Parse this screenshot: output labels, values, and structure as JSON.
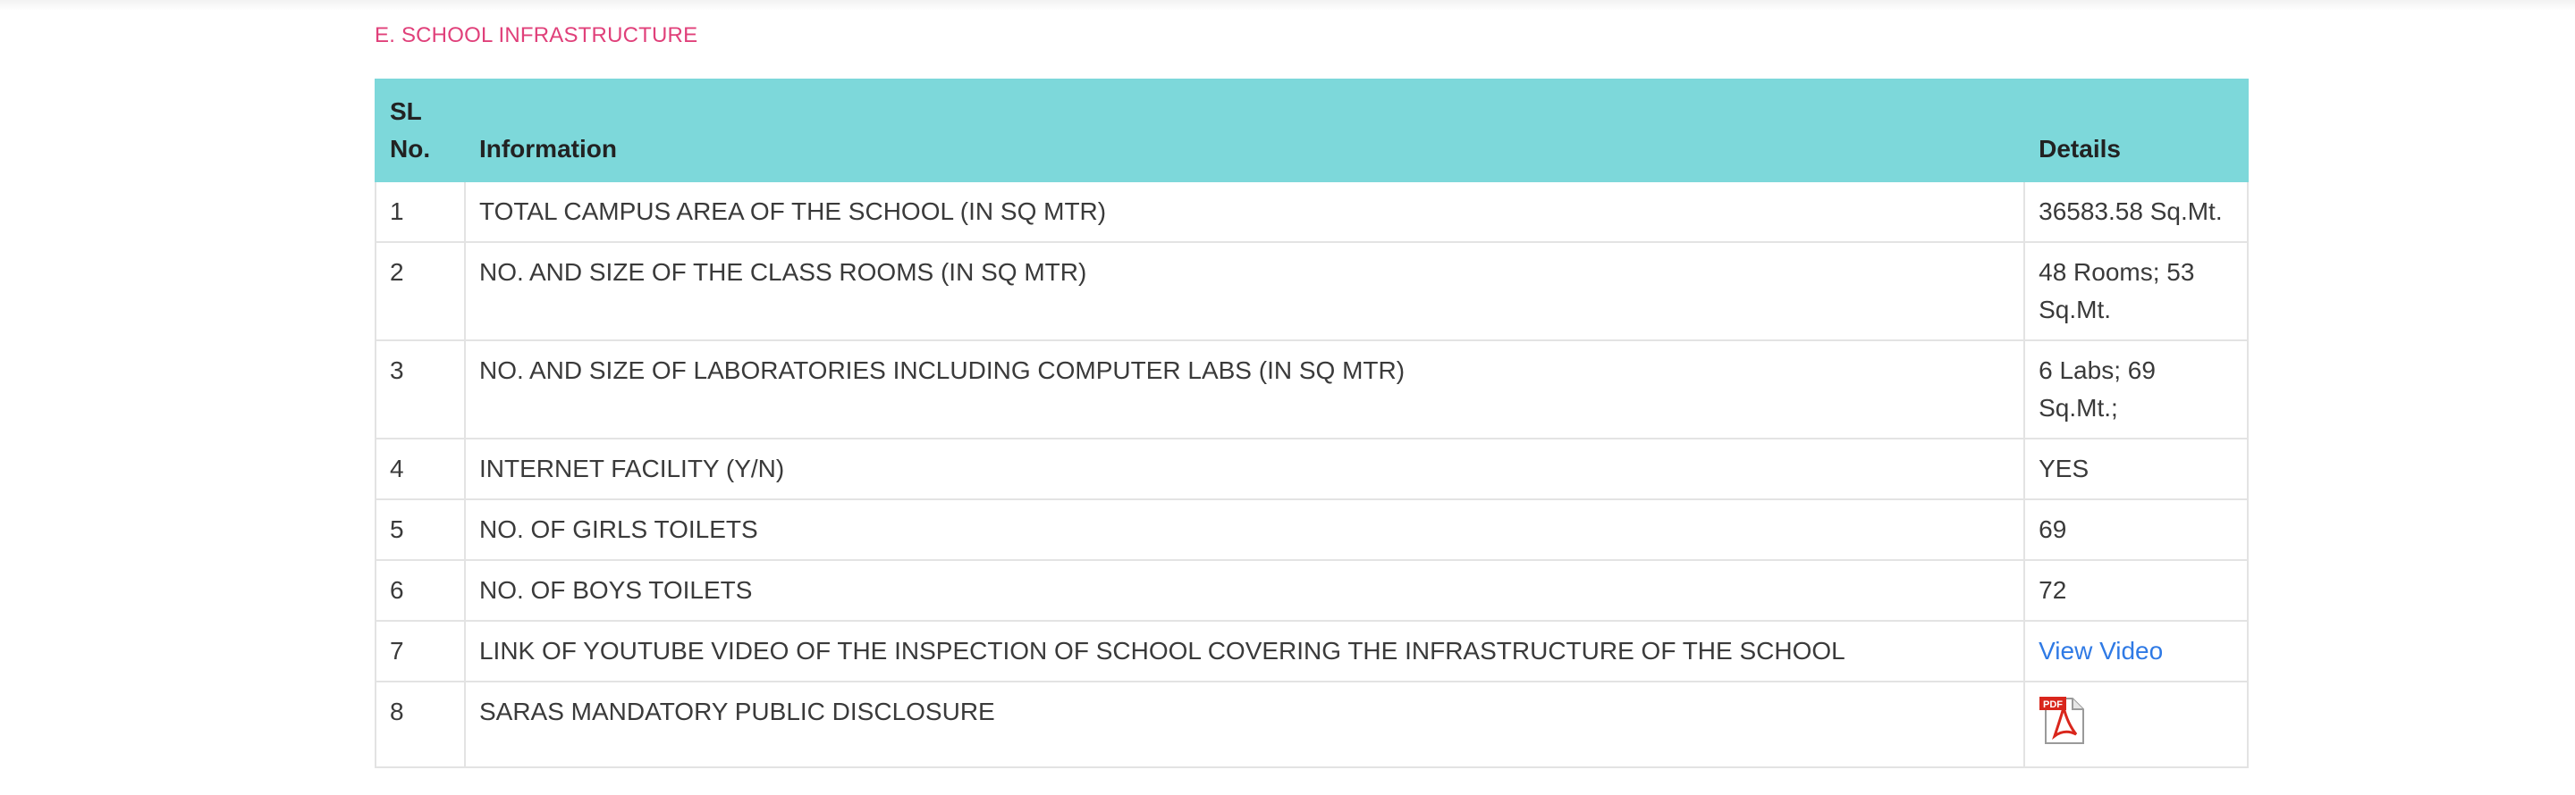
{
  "section": {
    "title": "E. SCHOOL INFRASTRUCTURE"
  },
  "table": {
    "headers": {
      "sl": "SL No.",
      "information": "Information",
      "details": "Details"
    },
    "rows": [
      {
        "sl": "1",
        "information": "TOTAL CAMPUS AREA OF THE SCHOOL (IN SQ MTR)",
        "details": "36583.58 Sq.Mt."
      },
      {
        "sl": "2",
        "information": "NO. AND SIZE OF THE CLASS ROOMS (IN SQ MTR)",
        "details": "48 Rooms; 53 Sq.Mt."
      },
      {
        "sl": "3",
        "information": "NO. AND SIZE OF LABORATORIES INCLUDING COMPUTER LABS (IN SQ MTR)",
        "details": "6 Labs; 69 Sq.Mt.;"
      },
      {
        "sl": "4",
        "information": "INTERNET FACILITY (Y/N)",
        "details": "YES"
      },
      {
        "sl": "5",
        "information": "NO. OF GIRLS TOILETS",
        "details": "69"
      },
      {
        "sl": "6",
        "information": "NO. OF BOYS TOILETS",
        "details": "72"
      },
      {
        "sl": "7",
        "information": "LINK OF YOUTUBE VIDEO OF THE INSPECTION OF SCHOOL COVERING THE INFRASTRUCTURE OF THE SCHOOL",
        "details": "View Video"
      },
      {
        "sl": "8",
        "information": "SARAS MANDATORY PUBLIC DISCLOSURE",
        "details_icon": "pdf-file-icon",
        "icon_label": "PDF"
      }
    ]
  },
  "colors": {
    "header_bg": "#7dd8da",
    "section_title": "#e0407a",
    "link": "#2f7ae5",
    "pdf_red": "#d9261c"
  }
}
